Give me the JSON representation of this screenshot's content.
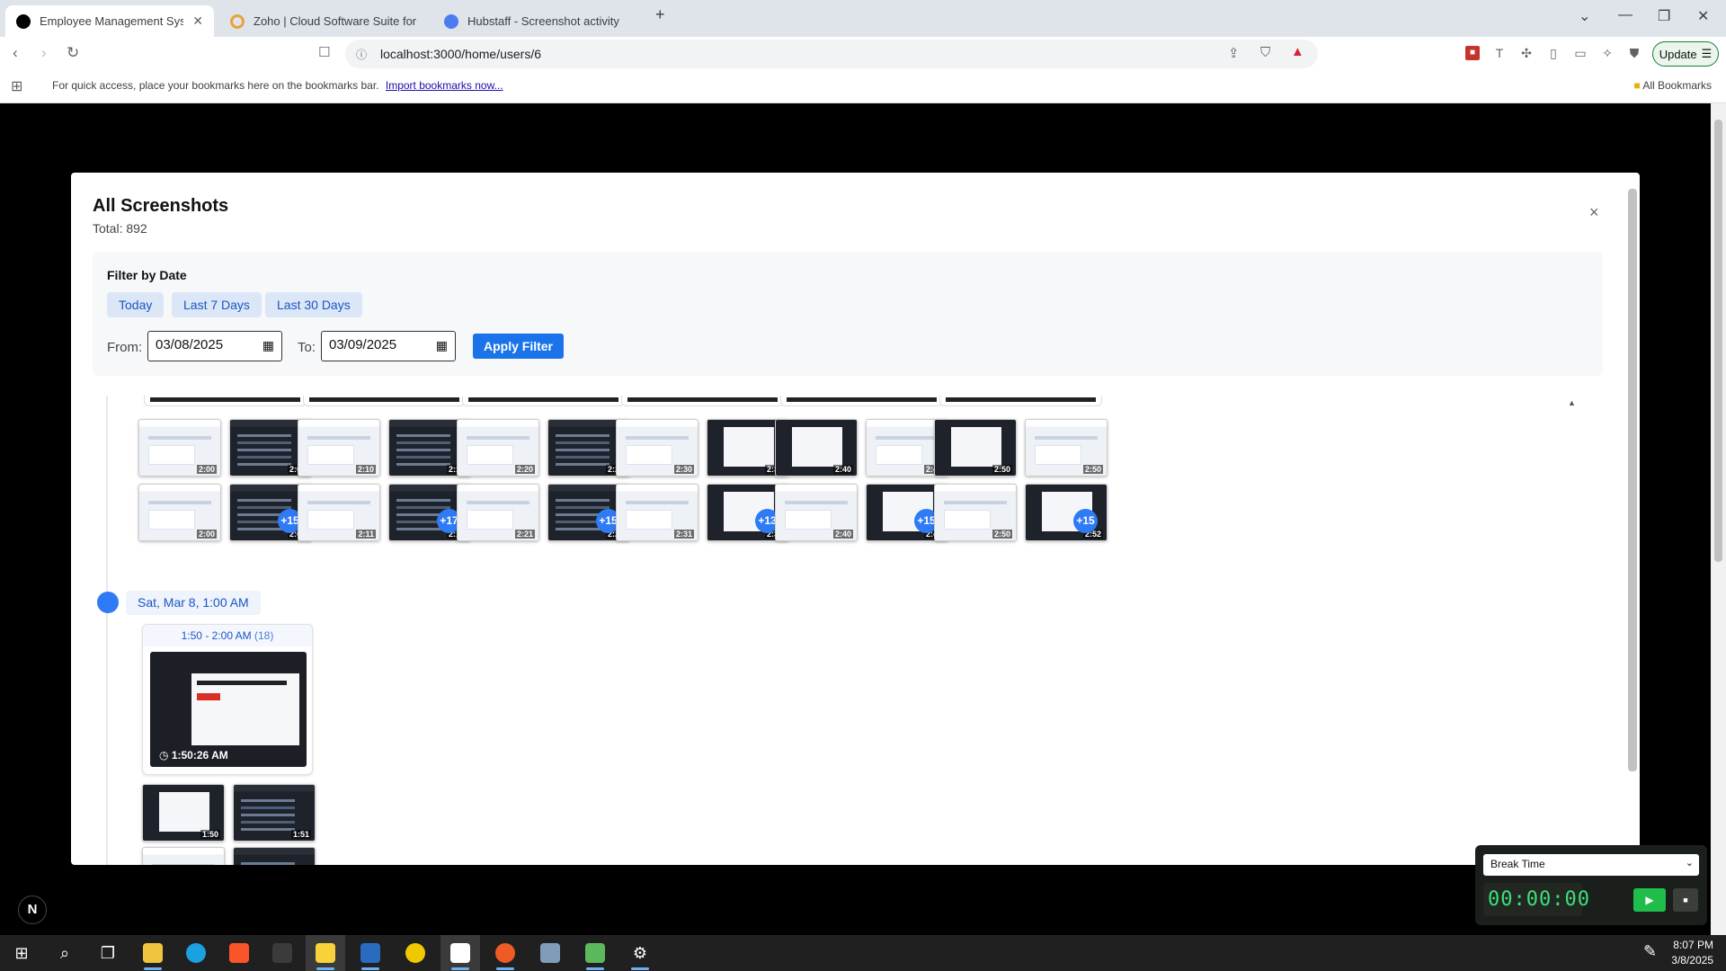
{
  "browser": {
    "tabs": [
      {
        "title": "Employee Management System",
        "active": true,
        "favicon_color": "#000000"
      },
      {
        "title": "Zoho | Cloud Software Suite for Bus",
        "active": false,
        "favicon_color": "#e8a33c"
      },
      {
        "title": "Hubstaff - Screenshot activity",
        "active": false,
        "favicon_color": "#4d7cf0"
      }
    ],
    "new_tab": "+",
    "url": "localhost:3000/home/users/6",
    "update_label": "Update",
    "bookmarks_message": "For quick access, place your bookmarks here on the bookmarks bar.",
    "import_link": "Import bookmarks now...",
    "all_bookmarks": "All Bookmarks"
  },
  "modal": {
    "title": "All Screenshots",
    "total": "Total: 892",
    "close": "×",
    "filter": {
      "title": "Filter by Date",
      "quick": [
        "Today",
        "Last 7 Days",
        "Last 30 Days"
      ],
      "from_label": "From:",
      "from_value": "03/08/2025",
      "to_label": "To:",
      "to_value": "03/09/2025",
      "apply_label": "Apply Filter"
    },
    "clusters": [
      {
        "rows": [
          [
            {
              "kind": "light",
              "time": "2:00"
            },
            {
              "kind": "dark",
              "time": "2:00"
            }
          ],
          [
            {
              "kind": "light",
              "time": "2:00"
            },
            {
              "kind": "dark",
              "time": "2:02",
              "more": "+15"
            }
          ]
        ]
      },
      {
        "rows": [
          [
            {
              "kind": "light",
              "time": "2:10"
            },
            {
              "kind": "dark",
              "time": "2:10"
            }
          ],
          [
            {
              "kind": "light",
              "time": "2:11"
            },
            {
              "kind": "dark",
              "time": "2:12",
              "more": "+17"
            }
          ]
        ]
      },
      {
        "rows": [
          [
            {
              "kind": "light",
              "time": "2:20"
            },
            {
              "kind": "dark",
              "time": "2:21"
            }
          ],
          [
            {
              "kind": "light",
              "time": "2:21"
            },
            {
              "kind": "dark",
              "time": "2:22",
              "more": "+15"
            }
          ]
        ]
      },
      {
        "rows": [
          [
            {
              "kind": "light",
              "time": "2:30"
            },
            {
              "kind": "mix",
              "time": "2:31"
            }
          ],
          [
            {
              "kind": "light",
              "time": "2:31"
            },
            {
              "kind": "mix",
              "time": "2:32",
              "more": "+13"
            }
          ]
        ]
      },
      {
        "rows": [
          [
            {
              "kind": "mix",
              "time": "2:40"
            },
            {
              "kind": "light",
              "time": "2:40"
            }
          ],
          [
            {
              "kind": "light",
              "time": "2:40"
            },
            {
              "kind": "mix",
              "time": "2:42",
              "more": "+15"
            }
          ]
        ]
      },
      {
        "rows": [
          [
            {
              "kind": "mix",
              "time": "2:50"
            },
            {
              "kind": "light",
              "time": "2:50"
            }
          ],
          [
            {
              "kind": "light",
              "time": "2:50"
            },
            {
              "kind": "mix",
              "time": "2:52",
              "more": "+15"
            }
          ]
        ]
      }
    ],
    "hour_group": {
      "label": "Sat, Mar 8, 1:00 AM",
      "range": "1:50 - 2:00 AM",
      "count": "(18)",
      "main_time": "1:50:26 AM",
      "small": [
        {
          "kind": "mix",
          "time": "1:50"
        },
        {
          "kind": "dark",
          "time": "1:51"
        },
        {
          "kind": "light",
          "time": ""
        },
        {
          "kind": "dark",
          "time": ""
        }
      ]
    }
  },
  "timer_widget": {
    "mode": "Break Time",
    "time": "00:00:00"
  },
  "n_badge": "N",
  "taskbar": {
    "time": "8:07 PM",
    "date": "3/8/2025"
  }
}
